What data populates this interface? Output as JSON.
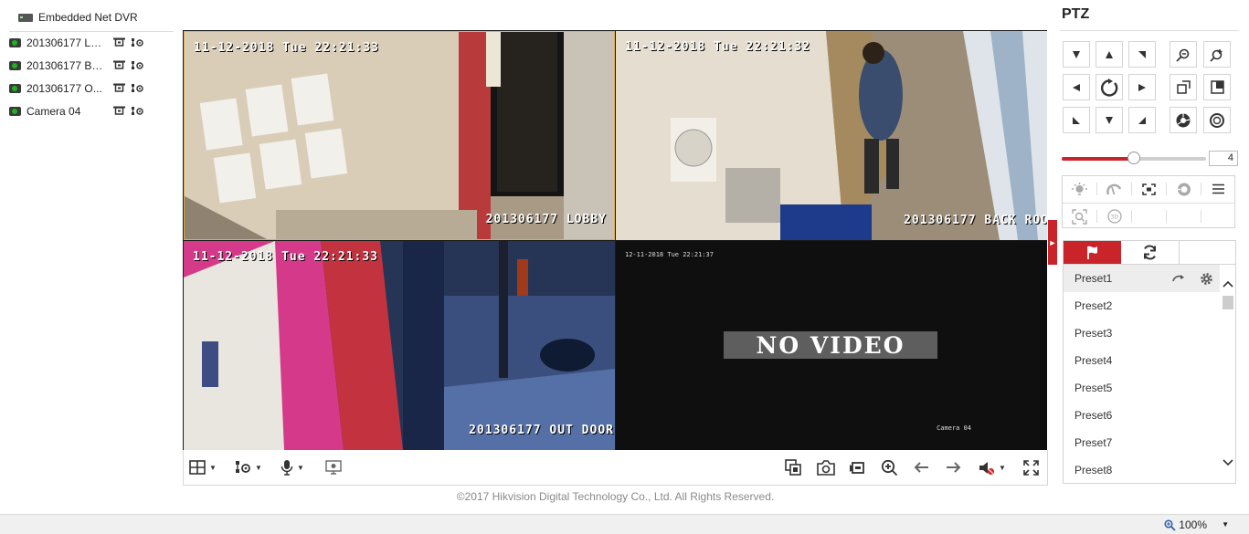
{
  "device_tree": {
    "root_label": "Embedded Net DVR",
    "cameras": [
      {
        "label": "201306177 LO..."
      },
      {
        "label": "201306177 BA..."
      },
      {
        "label": "201306177 O..."
      },
      {
        "label": "Camera 04"
      }
    ]
  },
  "video": {
    "panes": [
      {
        "timestamp": "11-12-2018 Tue 22:21:33",
        "name": "201306177 LOBBY"
      },
      {
        "timestamp": "11-12-2018 Tue 22:21:32",
        "name": "201306177 BACK ROO"
      },
      {
        "timestamp": "11-12-2018 Tue 22:21:33",
        "name": "201306177 OUT DOOR"
      },
      {
        "timestamp": "12-11-2018 Tue 22:21:37",
        "name": "Camera 04",
        "status": "NO VIDEO"
      }
    ]
  },
  "footer": {
    "copyright": "©2017 Hikvision Digital Technology Co., Ltd. All Rights Reserved."
  },
  "ptz": {
    "title": "PTZ",
    "speed": "4",
    "speed_value": 4,
    "speed_fraction": 0.5,
    "presets": [
      "Preset1",
      "Preset2",
      "Preset3",
      "Preset4",
      "Preset5",
      "Preset6",
      "Preset7",
      "Preset8"
    ]
  },
  "statusbar": {
    "zoom": "100%"
  },
  "colors": {
    "accent": "#c8242a",
    "selected_pane_border": "#e4b040"
  }
}
